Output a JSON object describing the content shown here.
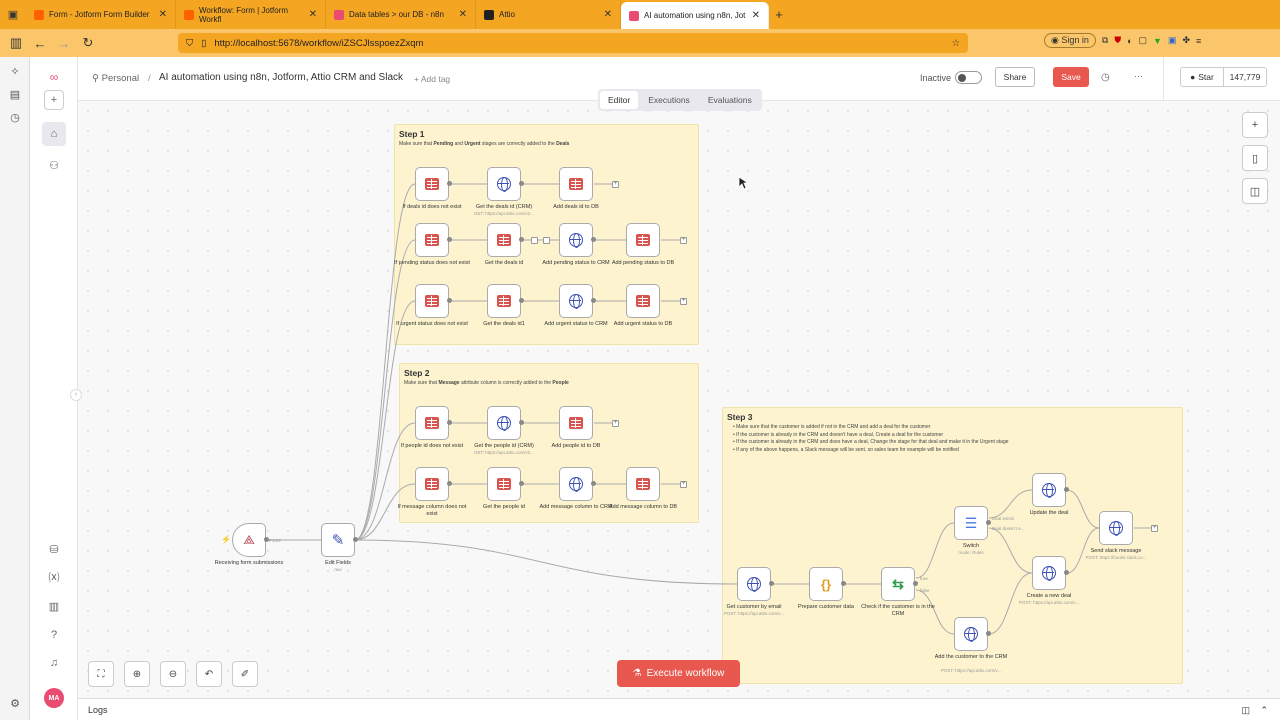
{
  "browser": {
    "tabs": [
      {
        "label": "Form - Jotform Form Builder",
        "color": "#ff6100"
      },
      {
        "label": "Workflow: Form | Jotform Workfl",
        "color": "#ff6100"
      },
      {
        "label": "Data tables > our DB - n8n",
        "color": "#ea4b71"
      },
      {
        "label": "Attio",
        "color": "#222222"
      },
      {
        "label": "AI automation using n8n, Jot",
        "color": "#ea4b71"
      }
    ],
    "new_tab": "+",
    "url": "http://localhost:5678/workflow/iZSCJlsspoezZxqm",
    "sign_in": "Sign in"
  },
  "header": {
    "breadcrumb_personal": "Personal",
    "separator": "/",
    "workflow_title": "AI automation using n8n, Jotform, Attio CRM and Slack",
    "add_tag": "+ Add tag",
    "status_label": "Inactive",
    "share_label": "Share",
    "save_label": "Save",
    "more": "···",
    "star_label": "Star",
    "star_count": "147,779"
  },
  "view_tabs": [
    "Editor",
    "Executions",
    "Evaluations"
  ],
  "step1": {
    "title": "Step 1",
    "desc_pre": "Make sure that ",
    "desc_b1": "Pending",
    "desc_mid": " and ",
    "desc_b2": "Urgent",
    "desc_mid2": " stages are correctly added to the ",
    "desc_b3": "Deals"
  },
  "step2": {
    "title": "Step 2",
    "desc_pre": "Make sure that ",
    "desc_b1": "Message",
    "desc_mid": " attribute column is correctly added to the ",
    "desc_b2": "People"
  },
  "step3": {
    "title": "Step 3",
    "bullets": [
      "Make sure that the customer is added if not in the CRM and add a deal for the customer",
      "If the customer is already in the CRM and doesn't have a deal, Create a deal for the customer",
      "If the customer is already in the CRM and does have a deal, Change the stage for that deal and make it in the Urgent stage",
      "If any of the above happens, a Slack message will be sent, so sales team for example will be notified"
    ]
  },
  "nodes": [
    {
      "label": "If deals id does not exist",
      "sub": "",
      "icon": "table"
    },
    {
      "label": "Get the deals id (CRM)",
      "sub": "GET: https://api.attio.com/v2...",
      "icon": "globe"
    },
    {
      "label": "Add deals id to DB",
      "sub": "",
      "icon": "table"
    },
    {
      "label": "If pending status does not exist",
      "sub": "",
      "icon": "table"
    },
    {
      "label": "Get the deals id",
      "sub": "",
      "icon": "table"
    },
    {
      "label": "Add pending status to CRM",
      "sub": "",
      "icon": "globe"
    },
    {
      "label": "Add pending status to DB",
      "sub": "",
      "icon": "table"
    },
    {
      "label": "If urgent status does not exist",
      "sub": "",
      "icon": "table"
    },
    {
      "label": "Get the deals id1",
      "sub": "",
      "icon": "table"
    },
    {
      "label": "Add urgent status to CRM",
      "sub": "",
      "icon": "globe"
    },
    {
      "label": "Add urgent status to DB",
      "sub": "",
      "icon": "table"
    },
    {
      "label": "If people id does not exist",
      "sub": "",
      "icon": "table"
    },
    {
      "label": "Get the people id (CRM)",
      "sub": "GET: https://api.attio.com/v2...",
      "icon": "globe"
    },
    {
      "label": "Add people id to DB",
      "sub": "",
      "icon": "table"
    },
    {
      "label": "If message column does not exist",
      "sub": "",
      "icon": "table"
    },
    {
      "label": "Get the people id",
      "sub": "",
      "icon": "table"
    },
    {
      "label": "Add message column to CRM",
      "sub": "",
      "icon": "globe"
    },
    {
      "label": "Add message column to DB",
      "sub": "",
      "icon": "table"
    },
    {
      "label": "Receiving form submissions",
      "sub": "",
      "icon": "webhook"
    },
    {
      "label": "Edit Fields",
      "sub": "raw",
      "icon": "pencil"
    },
    {
      "label": "Get customer by email",
      "sub": "POST: https://api.attio.com/v...",
      "icon": "globe"
    },
    {
      "label": "Prepare customer data",
      "sub": "",
      "icon": "code"
    },
    {
      "label": "Check if the customer is in the CRM",
      "sub": "",
      "icon": "if"
    },
    {
      "label": "Switch",
      "sub": "mode: Rules",
      "icon": "switch"
    },
    {
      "label": "Update the deal",
      "sub": "",
      "icon": "globe"
    },
    {
      "label": "Create a new deal",
      "sub": "POST: https://api.attio.com/v...",
      "icon": "globe"
    },
    {
      "label": "Add the customer to the CRM",
      "sub": "POST: https://api.attio.com/v...",
      "icon": "globe"
    },
    {
      "label": "Send slack message",
      "sub": "POST: https://hooks.slack.co...",
      "icon": "globe"
    }
  ],
  "edge_labels": {
    "post": "POST",
    "true_lbl": "true",
    "false_lbl": "false",
    "deal_exists": "Deal exists",
    "deal_doesnt": "Deal doesn't e..."
  },
  "execute_label": "Execute workflow",
  "logs_label": "Logs",
  "user_initials": "MA",
  "icons": {
    "home": "home-icon",
    "user": "user-icon",
    "plus": "plus-icon",
    "brand": "#ea4b71"
  }
}
